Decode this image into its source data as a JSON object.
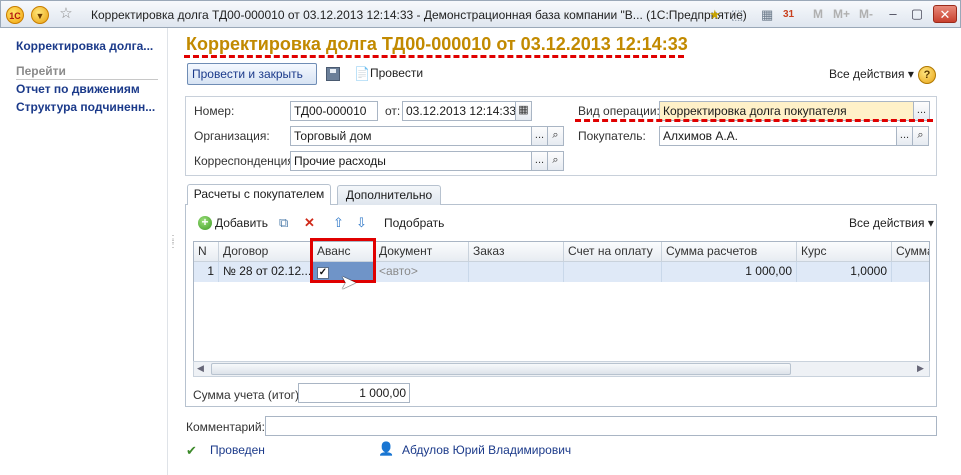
{
  "window": {
    "title": "Корректировка долга ТД00-000010 от 03.12.2013 12:14:33 - Демонстрационная база компании \"В...  (1С:Предприятие)",
    "logo": "1С",
    "toolbar_m": [
      "M",
      "M+",
      "M-"
    ],
    "calendar_day": "31"
  },
  "left_panel": {
    "items": [
      {
        "label": "Корректировка долга..."
      },
      {
        "label": "Перейти"
      },
      {
        "label": "Отчет по движениям"
      },
      {
        "label": "Структура подчиненн..."
      }
    ]
  },
  "form": {
    "title": "Корректировка долга ТД00-000010 от 03.12.2013 12:14:33",
    "toolbar": {
      "post_close_label": "Провести и закрыть",
      "post_label": "Провести",
      "all_actions_label": "Все действия",
      "help_symbol": "?"
    },
    "header": {
      "number_label": "Номер:",
      "number_value": "ТД00-000010",
      "date_label": "от:",
      "date_value": "03.12.2013 12:14:33",
      "org_label": "Организация:",
      "org_value": "Торговый дом",
      "corr_label": "Корреспонденция:",
      "corr_value": "Прочие расходы",
      "optype_label": "Вид операции:",
      "optype_value": "Корректировка долга покупателя",
      "buyer_label": "Покупатель:",
      "buyer_value": "Алхимов А.А."
    },
    "tabs": [
      {
        "label": "Расчеты с покупателем",
        "active": true
      },
      {
        "label": "Дополнительно",
        "active": false
      }
    ],
    "table_toolbar": {
      "add_label": "Добавить",
      "pick_label": "Подобрать",
      "all_actions_label": "Все действия"
    },
    "table": {
      "columns": [
        "N",
        "Договор",
        "Аванс",
        "Документ",
        "Заказ",
        "Счет на оплату",
        "Сумма расчетов",
        "Курс",
        "Сумма"
      ],
      "rows": [
        {
          "n": "1",
          "contract": "№ 28 от 02.12....",
          "advance": true,
          "document": "<авто>",
          "order": "",
          "invoice": "",
          "amount": "1 000,00",
          "rate": "1,0000",
          "sum": ""
        }
      ]
    },
    "total_label": "Сумма учета (итог):",
    "total_value": "1 000,00",
    "comment_label": "Комментарий:",
    "comment_value": "",
    "status_label": "Проведен",
    "author": "Абдулов Юрий Владимирович"
  },
  "colors": {
    "title_accent": "#c28a00",
    "highlight": "#e00000",
    "link": "#1b3a8a"
  }
}
